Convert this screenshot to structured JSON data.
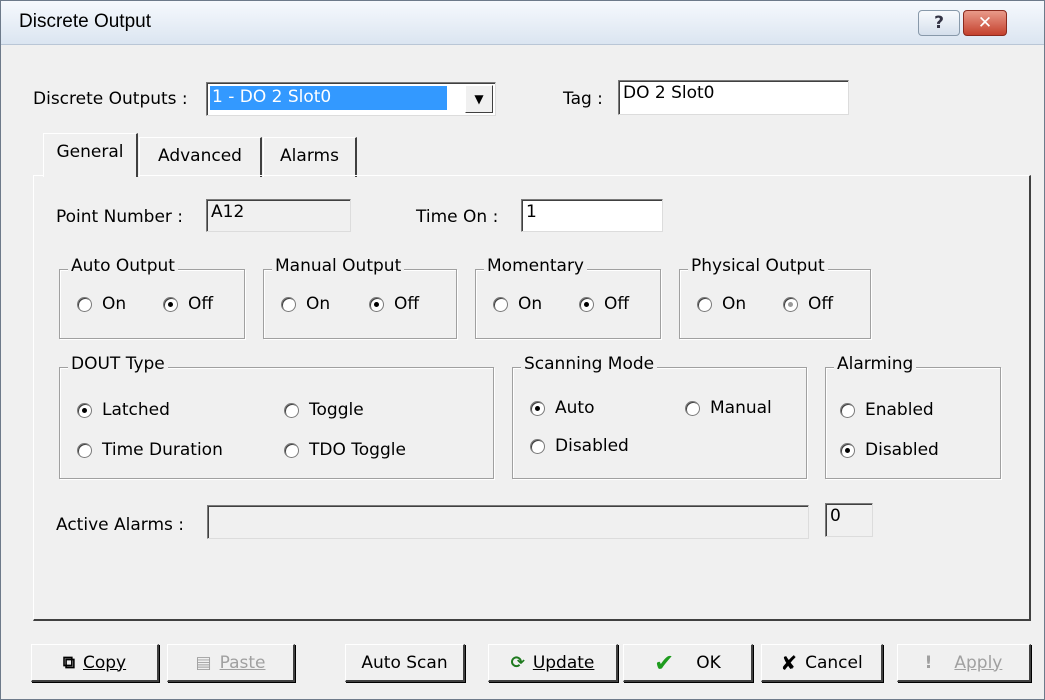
{
  "window": {
    "title": "Discrete Output",
    "help_label": "?",
    "close_label": "✕"
  },
  "header": {
    "outputs_label": "Discrete Outputs :",
    "outputs_value": "1 - DO 2 Slot0",
    "tag_label": "Tag :",
    "tag_value": "DO 2 Slot0"
  },
  "tabs": [
    {
      "label": "General"
    },
    {
      "label": "Advanced"
    },
    {
      "label": "Alarms"
    }
  ],
  "general": {
    "point_number_label": "Point Number :",
    "point_number_value": "A12",
    "time_on_label": "Time On :",
    "time_on_value": "1",
    "auto_output": {
      "title": "Auto Output",
      "on": "On",
      "off": "Off",
      "selected": "Off"
    },
    "manual_output": {
      "title": "Manual Output",
      "on": "On",
      "off": "Off",
      "selected": "Off"
    },
    "momentary": {
      "title": "Momentary",
      "on": "On",
      "off": "Off",
      "selected": "Off"
    },
    "physical_output": {
      "title": "Physical Output",
      "on": "On",
      "off": "Off",
      "selected": "Off"
    },
    "dout_type": {
      "title": "DOUT Type",
      "latched": "Latched",
      "toggle": "Toggle",
      "time_duration": "Time Duration",
      "tdo_toggle": "TDO Toggle",
      "selected": "Latched"
    },
    "scanning_mode": {
      "title": "Scanning Mode",
      "auto": "Auto",
      "manual": "Manual",
      "disabled": "Disabled",
      "selected": "Auto"
    },
    "alarming": {
      "title": "Alarming",
      "enabled": "Enabled",
      "disabled": "Disabled",
      "selected": "Disabled"
    },
    "active_alarms_label": "Active Alarms :",
    "active_alarms_value": "",
    "active_alarms_count": "0"
  },
  "buttons": {
    "copy": "Copy",
    "paste": "Paste",
    "auto_scan": "Auto Scan",
    "update": "Update",
    "ok": "OK",
    "cancel": "Cancel",
    "apply": "Apply"
  },
  "icons": {
    "copy": "copy-icon",
    "paste": "paste-icon",
    "update": "refresh-icon",
    "ok": "checkmark-icon",
    "cancel": "x-icon",
    "apply": "exclamation-icon"
  },
  "colors": {
    "selection": "#3399ff",
    "ok_green": "#1e9c1e",
    "cancel_dark": "#1a1a1a"
  }
}
